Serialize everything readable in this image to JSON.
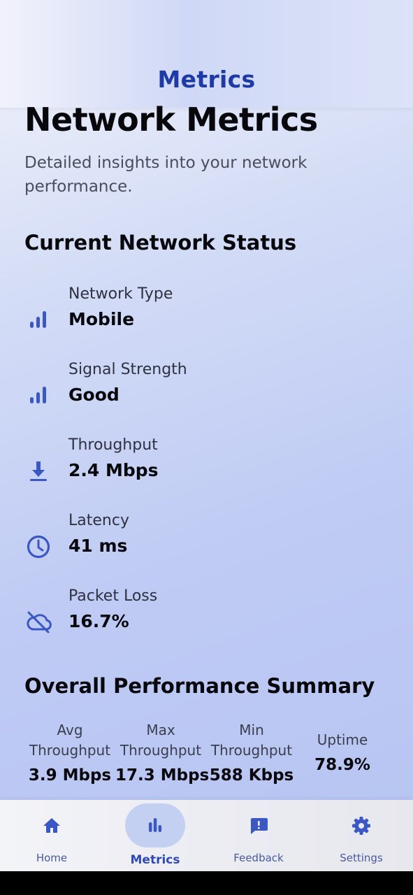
{
  "app_bar": {
    "title": "Metrics"
  },
  "page": {
    "title": "Network Metrics",
    "subtitle": "Detailed insights into your network performance."
  },
  "current_status": {
    "heading": "Current Network Status",
    "items": [
      {
        "label": "Network Type",
        "value": "Mobile",
        "icon": "signal-bars-icon"
      },
      {
        "label": "Signal Strength",
        "value": "Good",
        "icon": "signal-bars-icon"
      },
      {
        "label": "Throughput",
        "value": "2.4 Mbps",
        "icon": "download-icon"
      },
      {
        "label": "Latency",
        "value": "41 ms",
        "icon": "clock-icon"
      },
      {
        "label": "Packet Loss",
        "value": "16.7%",
        "icon": "cloud-off-icon"
      }
    ]
  },
  "summary": {
    "heading": "Overall Performance Summary",
    "stats": [
      {
        "label_line1": "Avg",
        "label_line2": "Throughput",
        "value": "3.9 Mbps"
      },
      {
        "label_line1": "Max",
        "label_line2": "Throughput",
        "value": "17.3 Mbps"
      },
      {
        "label_line1": "Min",
        "label_line2": "Throughput",
        "value": "588 Kbps"
      },
      {
        "label": "Uptime",
        "value": "78.9%"
      }
    ]
  },
  "nav": {
    "items": [
      {
        "label": "Home",
        "icon": "home-icon",
        "active": false
      },
      {
        "label": "Metrics",
        "icon": "bar-chart-icon",
        "active": true
      },
      {
        "label": "Feedback",
        "icon": "feedback-icon",
        "active": false
      },
      {
        "label": "Settings",
        "icon": "gear-icon",
        "active": false
      }
    ]
  },
  "colors": {
    "accent": "#3b57c4",
    "title_blue": "#1d3aa6",
    "nav_pill": "#c4d0f1"
  }
}
